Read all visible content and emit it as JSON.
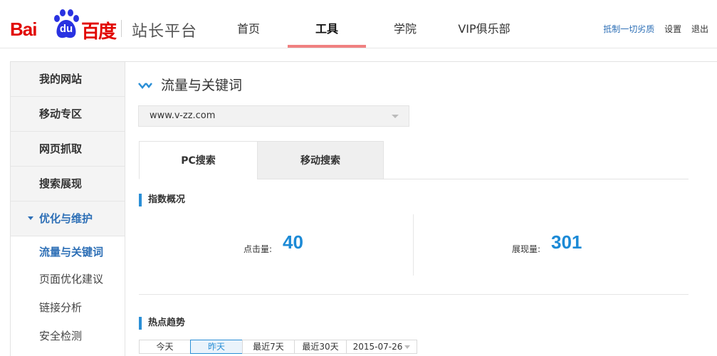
{
  "header": {
    "logo_bai": "Bai",
    "logo_du": "du",
    "logo_cn": "百度",
    "platform_title": "站长平台",
    "nav": [
      {
        "label": "首页"
      },
      {
        "label": "工具"
      },
      {
        "label": "学院"
      },
      {
        "label": "VIP俱乐部"
      }
    ],
    "active_nav": "工具",
    "links": {
      "campaign": "抵制一切劣质",
      "settings": "设置",
      "logout": "退出"
    }
  },
  "sidebar": {
    "items": [
      {
        "label": "我的网站"
      },
      {
        "label": "移动专区"
      },
      {
        "label": "网页抓取"
      },
      {
        "label": "搜索展现"
      }
    ],
    "open_group": {
      "label": "优化与维护",
      "children": [
        {
          "label": "流量与关键词"
        },
        {
          "label": "页面优化建议"
        },
        {
          "label": "链接分析"
        },
        {
          "label": "安全检测"
        }
      ]
    }
  },
  "main": {
    "title": "流量与关键词",
    "site_select": "www.v-zz.com",
    "tabs": [
      {
        "label": "PC搜索"
      },
      {
        "label": "移动搜索"
      }
    ],
    "overview_title": "指数概况",
    "stats": {
      "clicks_label": "点击量:",
      "clicks_value": "40",
      "impressions_label": "展现量:",
      "impressions_value": "301"
    },
    "trend_title": "热点趋势",
    "ranges": [
      {
        "label": "今天"
      },
      {
        "label": "昨天"
      },
      {
        "label": "最近7天"
      },
      {
        "label": "最近30天"
      },
      {
        "label": "2015-07-26"
      }
    ],
    "active_range": "昨天"
  },
  "colors": {
    "brand_red": "#e10601",
    "accent_blue": "#1c8ad6",
    "nav_underline": "#f08080"
  }
}
